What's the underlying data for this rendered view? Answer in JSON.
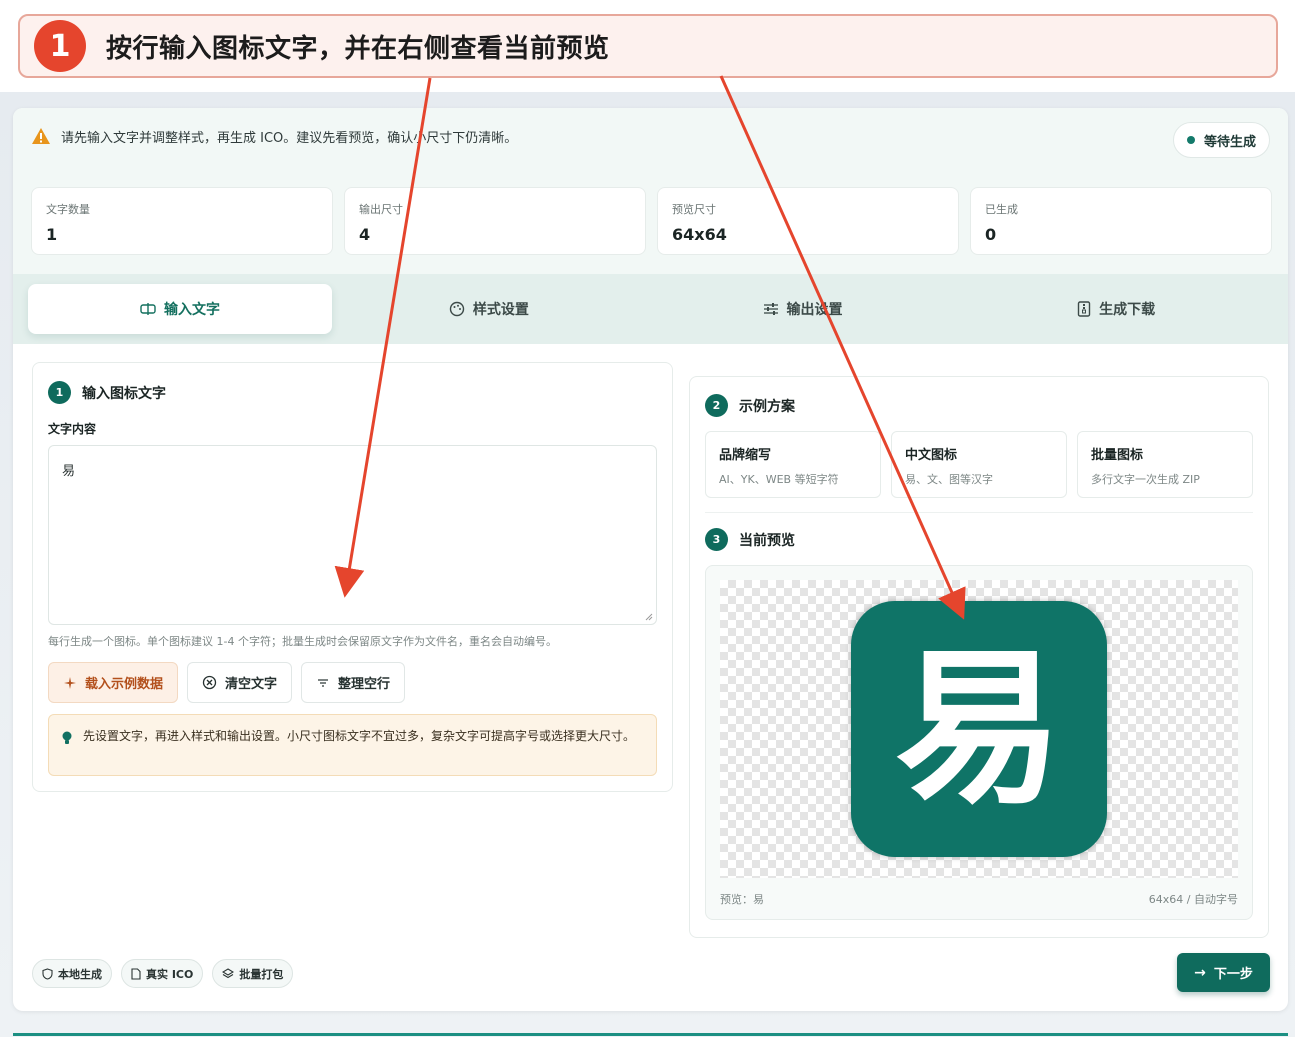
{
  "callout": {
    "number": "1",
    "text": "按行输入图标文字，并在右侧查看当前预览"
  },
  "notice": {
    "text": "请先输入文字并调整样式，再生成 ICO。建议先看预览，确认小尺寸下仍清晰。"
  },
  "status": {
    "label": "等待生成"
  },
  "stats": [
    {
      "label": "文字数量",
      "value": "1"
    },
    {
      "label": "输出尺寸",
      "value": "4"
    },
    {
      "label": "预览尺寸",
      "value": "64x64"
    },
    {
      "label": "已生成",
      "value": "0"
    }
  ],
  "tabs": [
    {
      "label": "输入文字",
      "icon": "input-icon",
      "active": true
    },
    {
      "label": "样式设置",
      "icon": "palette-icon",
      "active": false
    },
    {
      "label": "输出设置",
      "icon": "sliders-icon",
      "active": false
    },
    {
      "label": "生成下载",
      "icon": "file-zip-icon",
      "active": false
    }
  ],
  "input_section": {
    "number": "1",
    "title": "输入图标文字",
    "field_label": "文字内容",
    "value": "易",
    "hint": "每行生成一个图标。单个图标建议 1-4 个字符；批量生成时会保留原文字作为文件名，重名会自动编号。",
    "buttons": {
      "load": "载入示例数据",
      "clear": "清空文字",
      "tidy": "整理空行"
    },
    "tip": "先设置文字，再进入样式和输出设置。小尺寸图标文字不宜过多，复杂文字可提高字号或选择更大尺寸。"
  },
  "examples_section": {
    "number": "2",
    "title": "示例方案",
    "items": [
      {
        "title": "品牌缩写",
        "desc": "AI、YK、WEB 等短字符"
      },
      {
        "title": "中文图标",
        "desc": "易、文、图等汉字"
      },
      {
        "title": "批量图标",
        "desc": "多行文字一次生成 ZIP"
      }
    ]
  },
  "preview_section": {
    "number": "3",
    "title": "当前预览",
    "char": "易",
    "footer_left": "预览：易",
    "footer_right": "64x64 / 自动字号"
  },
  "footer": {
    "badges": [
      {
        "label": "本地生成",
        "icon": "shield-icon"
      },
      {
        "label": "真实 ICO",
        "icon": "file-icon"
      },
      {
        "label": "批量打包",
        "icon": "layers-icon"
      }
    ],
    "next": "下一步"
  },
  "colors": {
    "accent": "#0f6b5d",
    "icon_bg": "#0f7467",
    "callout_red": "#e5452d",
    "arrow": "#e5452d"
  }
}
